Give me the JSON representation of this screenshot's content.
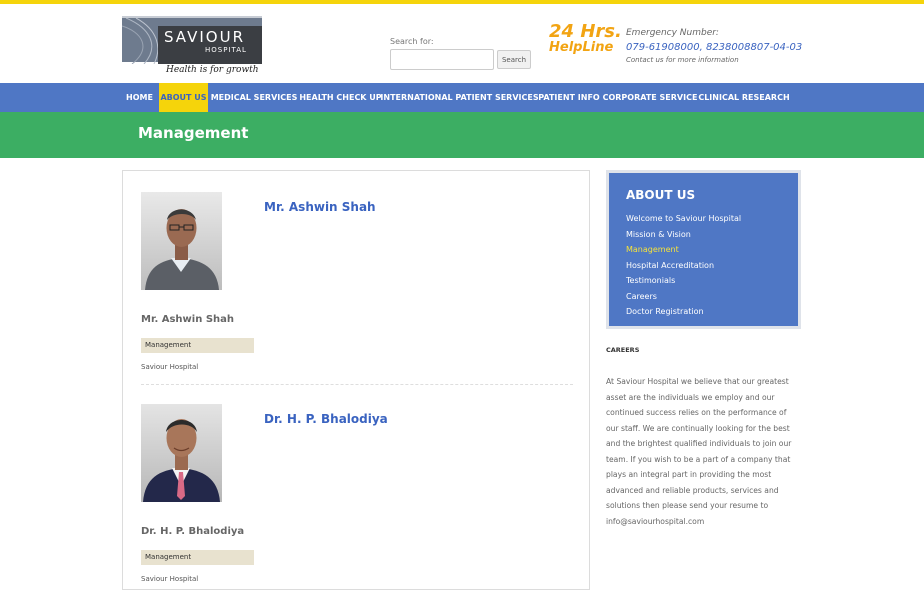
{
  "header": {
    "logo": {
      "name": "SAVIOUR",
      "sub": "HOSPITAL",
      "tagline": "Health is for growth"
    },
    "search": {
      "label": "Search for:",
      "placeholder": "",
      "button": "Search"
    },
    "helpline": {
      "line1": "24 Hrs.",
      "line2": "HelpLine"
    },
    "emergency": {
      "label": "Emergency Number:",
      "numbers": "079-61908000, 8238008807-04-03",
      "info": "Contact us for more information"
    }
  },
  "nav": {
    "items": [
      {
        "label": "HOME"
      },
      {
        "label": "ABOUT US"
      },
      {
        "label": "MEDICAL SERVICES"
      },
      {
        "label": "HEALTH CHECK UP"
      },
      {
        "label": "INTERNATIONAL PATIENT SERVICES"
      },
      {
        "label": "PATIENT INFO"
      },
      {
        "label": "CORPORATE SERVICE"
      },
      {
        "label": "CLINICAL RESEARCH"
      }
    ],
    "active_index": 1
  },
  "banner": {
    "title": "Management"
  },
  "people": [
    {
      "title_name": "Mr. Ashwin Shah",
      "name": "Mr. Ashwin Shah",
      "tag": "Management",
      "org": "Saviour Hospital"
    },
    {
      "title_name": "Dr. H. P. Bhalodiya",
      "name": "Dr. H. P. Bhalodiya",
      "tag": "Management",
      "org": "Saviour Hospital"
    }
  ],
  "sidebar": {
    "title": "ABOUT US",
    "items": [
      {
        "label": "Welcome to Saviour Hospital"
      },
      {
        "label": "Mission & Vision"
      },
      {
        "label": "Management"
      },
      {
        "label": "Hospital Accreditation"
      },
      {
        "label": "Testimonials"
      },
      {
        "label": "Careers"
      },
      {
        "label": "Doctor Registration"
      }
    ],
    "current_index": 2,
    "careers_heading": "CAREERS",
    "careers_text": "At Saviour Hospital we believe that our greatest asset are the individuals we employ and our continued success relies on the performance of our staff. We are continually looking for the best and the brightest qualified individuals to join our team. If you wish to be a part of a company that plays an integral part in providing the most advanced and reliable products, services and solutions then please send your resume to info@saviourhospital.com"
  },
  "colors": {
    "nav_blue": "#4f77c5",
    "accent_yellow": "#f5d40b",
    "banner_green": "#3cae63",
    "helpline_orange": "#f2a413"
  }
}
